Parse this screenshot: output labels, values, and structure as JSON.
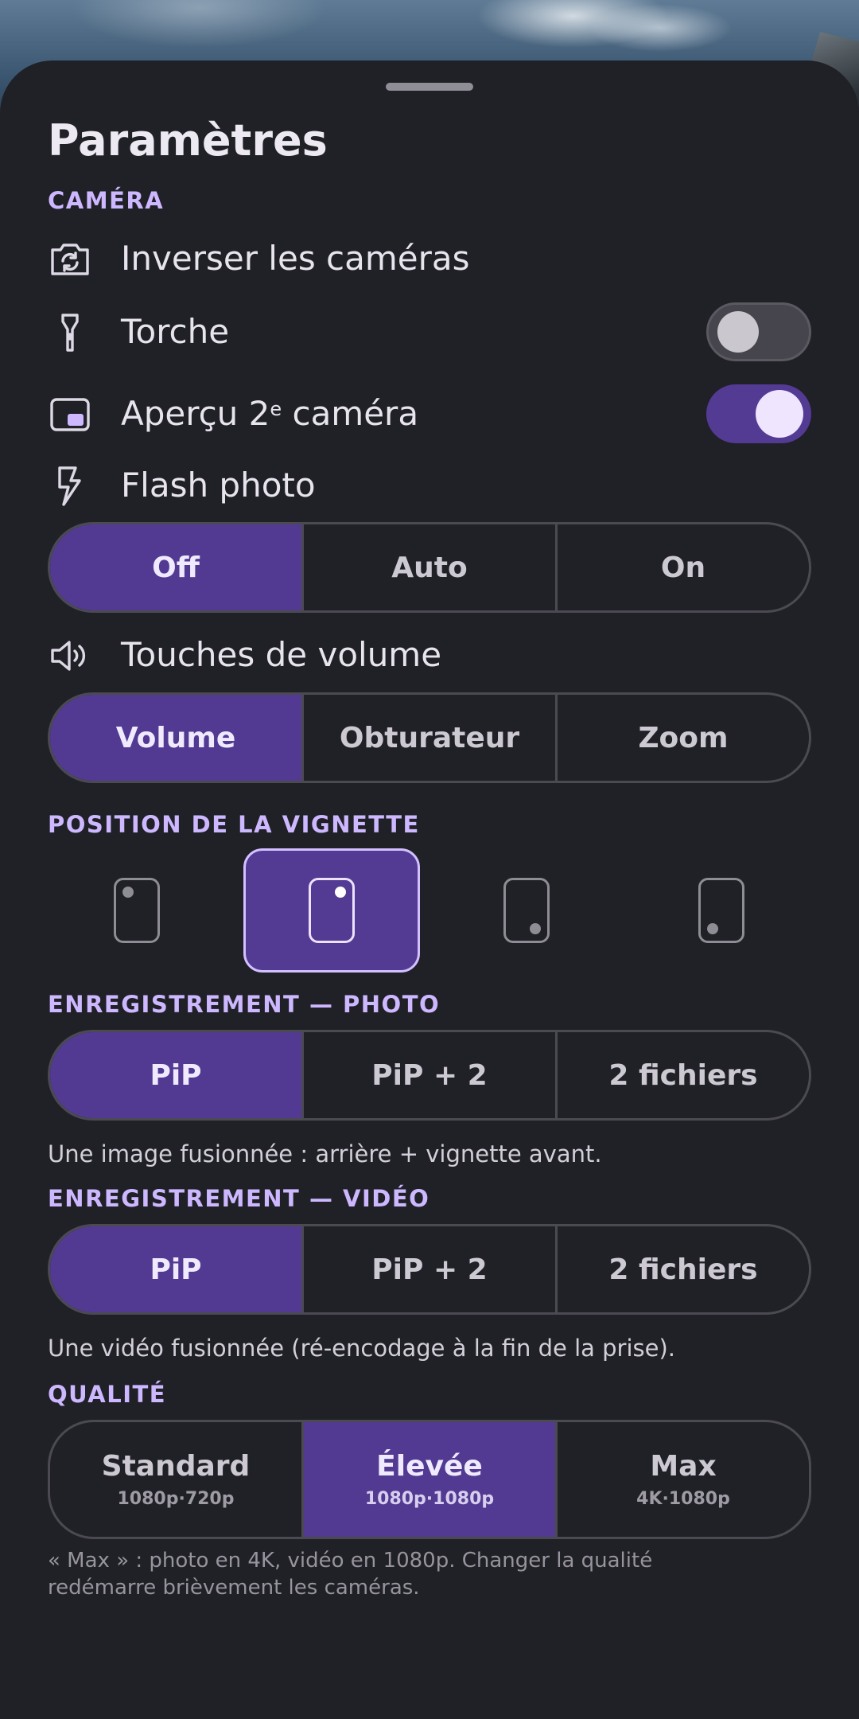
{
  "sheet": {
    "title": "Paramètres"
  },
  "camera": {
    "section_label": "CAMÉRA",
    "switch_label": "Inverser les caméras",
    "torch_label": "Torche",
    "torch_on": false,
    "preview_label": "Aperçu 2",
    "preview_sup": "e",
    "preview_label_suffix": " caméra",
    "preview_on": true,
    "flash_label": "Flash photo",
    "flash_options": [
      "Off",
      "Auto",
      "On"
    ],
    "flash_selected": "Off",
    "volume_label": "Touches de volume",
    "volume_options": [
      "Volume",
      "Obturateur",
      "Zoom"
    ],
    "volume_selected": "Volume"
  },
  "thumbnail": {
    "section_label": "POSITION DE LA VIGNETTE",
    "positions": [
      "top-left",
      "top-right",
      "bottom-right",
      "bottom-left"
    ],
    "selected": "top-right"
  },
  "photo": {
    "section_label": "ENREGISTREMENT — PHOTO",
    "options": [
      "PiP",
      "PiP + 2",
      "2 fichiers"
    ],
    "selected": "PiP",
    "description": "Une image fusionnée : arrière + vignette avant."
  },
  "video": {
    "section_label": "ENREGISTREMENT — VIDÉO",
    "options": [
      "PiP",
      "PiP + 2",
      "2 fichiers"
    ],
    "selected": "PiP",
    "description": "Une vidéo fusionnée (ré-encodage à la fin de la prise)."
  },
  "quality": {
    "section_label": "QUALITÉ",
    "options": [
      {
        "label": "Standard",
        "detail": "1080p·720p"
      },
      {
        "label": "Élevée",
        "detail": "1080p·1080p"
      },
      {
        "label": "Max",
        "detail": "4K·1080p"
      }
    ],
    "selected": "Élevée",
    "note": "« Max » : photo en 4K, vidéo en 1080p. Changer la qualité redémarre brièvement les caméras."
  },
  "colors": {
    "accent": "#533a92",
    "section_text": "#cdb8ff",
    "sheet_bg": "#202027"
  },
  "icons": {
    "switch": "camera-switch-icon",
    "torch": "torch-icon",
    "preview": "picture-in-picture-icon",
    "flash": "flash-icon",
    "volume": "volume-icon"
  }
}
